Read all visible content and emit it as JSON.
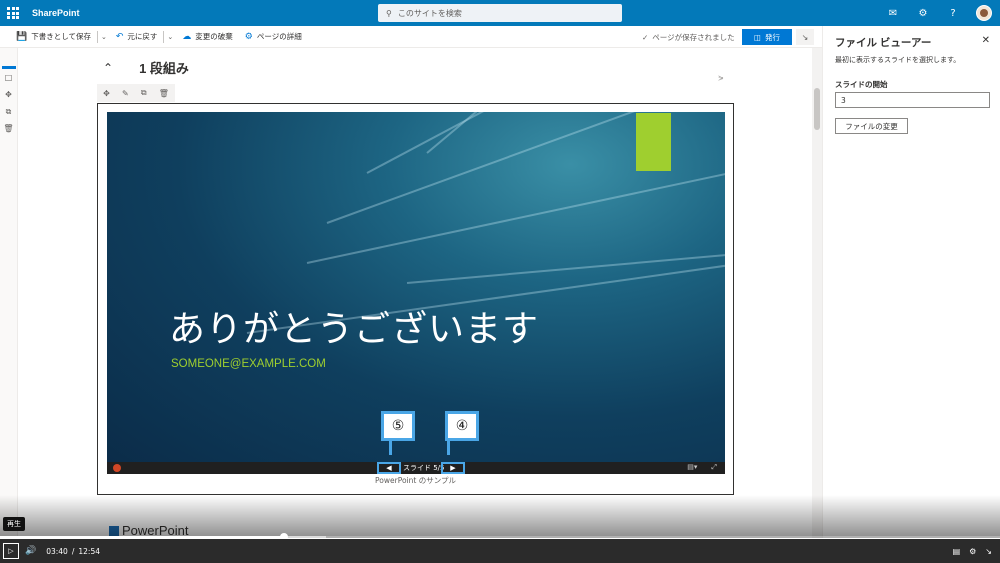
{
  "app": {
    "brand": "SharePoint"
  },
  "search": {
    "placeholder": "このサイトを検索"
  },
  "toolbar": {
    "save_draft": "下書きとして保存",
    "undo": "元に戻す",
    "discard": "変更の破棄",
    "page_details": "ページの詳細",
    "saved_status": "ページが保存されました",
    "publish": "発行"
  },
  "section": {
    "title": "1 段組み"
  },
  "slide": {
    "title": "ありがとうございます",
    "email": "SOMEONE@EXAMPLE.COM",
    "counter": "スライド 5/5",
    "caption": "PowerPoint のサンプル"
  },
  "callouts": {
    "prev": "⑤",
    "next": "④"
  },
  "next_heading": "PowerPoint",
  "pane": {
    "title": "ファイル ビューアー",
    "description": "最初に表示するスライドを選択します。",
    "start_label": "スライドの開始",
    "start_value": "3",
    "change_file": "ファイルの変更"
  },
  "video": {
    "tooltip": "再生",
    "current_time": "03:40",
    "separator": "/",
    "total_time": "12:54",
    "progress_fraction": 0.284,
    "buffered_fraction": 0.326
  },
  "colors": {
    "suite": "#0379b9",
    "accent": "#0078d4",
    "slide_green": "#9fcf2f",
    "callout_border": "#4aa6e6"
  }
}
